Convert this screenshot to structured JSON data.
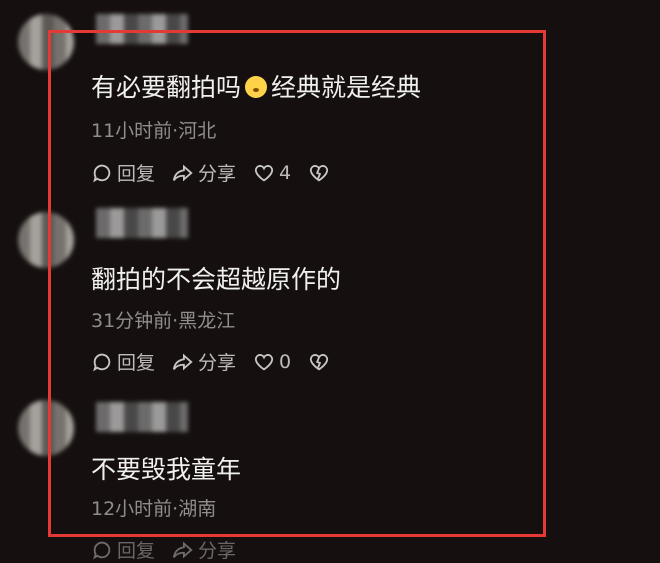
{
  "comments": [
    {
      "text_part1": "有必要翻拍吗",
      "emoji": "flushed-face",
      "text_part2": "经典就是经典",
      "meta": "11小时前·河北",
      "reply": "回复",
      "share": "分享",
      "likes": "4"
    },
    {
      "text_part1": "翻拍的不会超越原作的",
      "meta": "31分钟前·黑龙江",
      "reply": "回复",
      "share": "分享",
      "likes": "0"
    },
    {
      "text_part1": "不要毁我童年",
      "meta": "12小时前·湖南",
      "reply": "回复",
      "share": "分享"
    }
  ],
  "colors": {
    "highlight_frame": "#e53935",
    "background": "#15100f"
  }
}
